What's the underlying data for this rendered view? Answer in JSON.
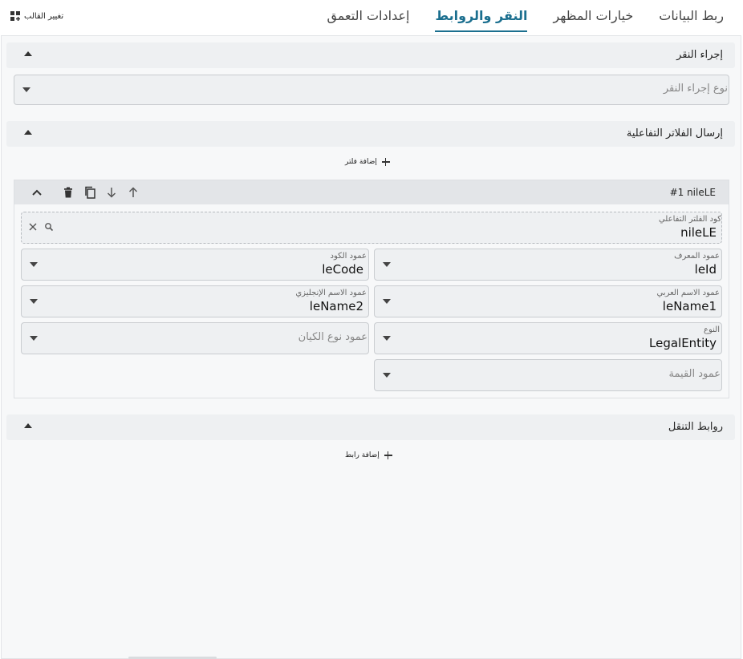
{
  "header": {
    "change_template_label": "تغيير القالب",
    "tabs": [
      {
        "label": "ربط البيانات",
        "active": false
      },
      {
        "label": "خيارات المظهر",
        "active": false
      },
      {
        "label": "النقر والروابط",
        "active": true
      },
      {
        "label": "إعدادات التعمق",
        "active": false
      }
    ]
  },
  "click_action": {
    "title": "إجراء النقر",
    "type_placeholder": "نوع إجراء النقر"
  },
  "interactive_filters": {
    "title": "إرسال الفلاتر التفاعلية",
    "add_filter_label": "إضافة فلتر",
    "item": {
      "title": "#1  nileLE",
      "code_field": {
        "label": "كود الفلتر التفاعلي",
        "value": "nileLE"
      },
      "id_column": {
        "label": "عمود المعرف",
        "value": "leId"
      },
      "code_column": {
        "label": "عمود الكود",
        "value": "leCode"
      },
      "arabic_name_column": {
        "label": "عمود الاسم العربي",
        "value": "leName1"
      },
      "english_name_column": {
        "label": "عمود الاسم الإنجليزي",
        "value": "leName2"
      },
      "type": {
        "label": "النوع",
        "value": "LegalEntity"
      },
      "entity_type_column": {
        "placeholder": "عمود نوع الكيان"
      },
      "value_column": {
        "placeholder": "عمود القيمة"
      }
    }
  },
  "navigation_links": {
    "title": "روابط التنقل",
    "add_link_label": "إضافة رابط"
  },
  "colors": {
    "accent": "#1b6f8f",
    "panel_bg": "#f7f8f9",
    "section_bg": "#eef0f2"
  }
}
